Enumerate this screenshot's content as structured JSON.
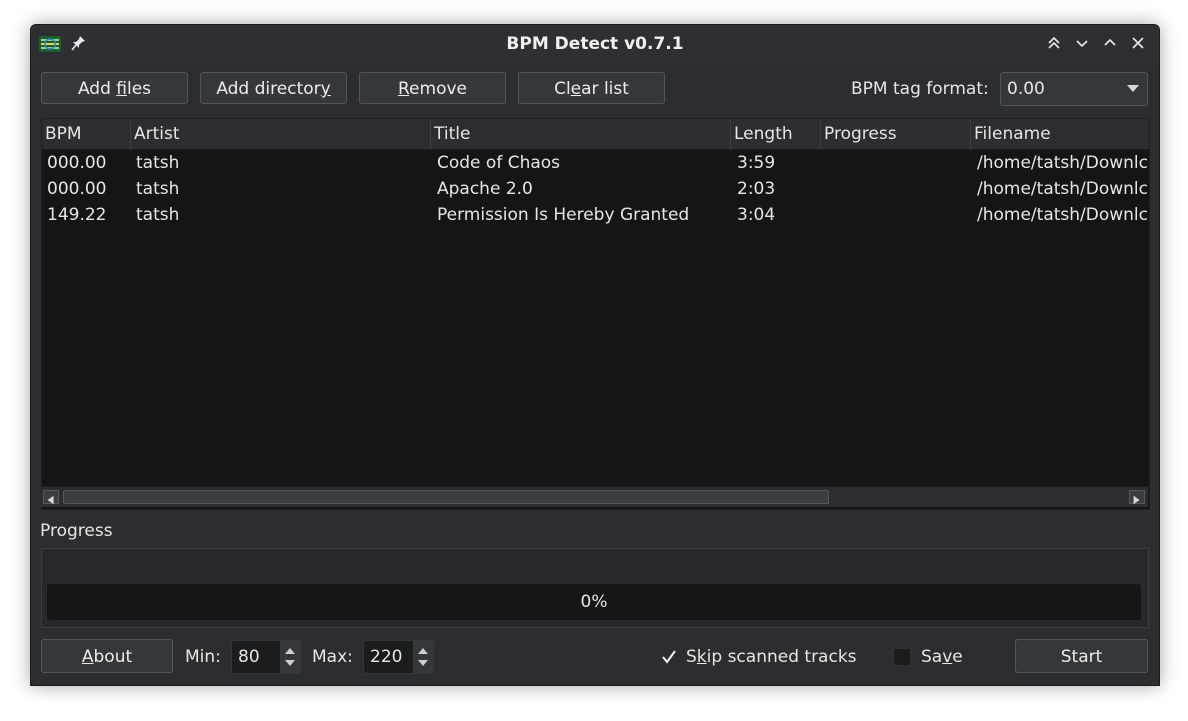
{
  "window": {
    "title": "BPM Detect v0.7.1",
    "icons": [
      "app-icon",
      "pin-icon",
      "keep-above-icon",
      "minimize-icon",
      "maximize-icon",
      "close-icon"
    ]
  },
  "toolbar": {
    "add_files": {
      "pre": "Add ",
      "key": "f",
      "post": "iles"
    },
    "add_directory": {
      "pre": "Add director",
      "key": "y",
      "post": ""
    },
    "remove": {
      "pre": "",
      "key": "R",
      "post": "emove"
    },
    "clear_list": {
      "pre": "Cl",
      "key": "e",
      "post": "ar list"
    },
    "bpm_tag_format_label": "BPM tag format:",
    "bpm_tag_format_value": "0.00"
  },
  "table": {
    "columns": [
      "BPM",
      "Artist",
      "Title",
      "Length",
      "Progress",
      "Filename"
    ],
    "rows": [
      {
        "bpm": "000.00",
        "artist": "tatsh",
        "title": "Code of Chaos",
        "length": "3:59",
        "progress": "",
        "filename": "/home/tatsh/Downlc"
      },
      {
        "bpm": "000.00",
        "artist": "tatsh",
        "title": "Apache 2.0",
        "length": "2:03",
        "progress": "",
        "filename": "/home/tatsh/Downlc"
      },
      {
        "bpm": "149.22",
        "artist": "tatsh",
        "title": "Permission Is Hereby Granted",
        "length": "3:04",
        "progress": "",
        "filename": "/home/tatsh/Downlc"
      }
    ]
  },
  "progress": {
    "label": "Progress",
    "percent_text": "0%",
    "fraction": 0
  },
  "footer": {
    "about": {
      "pre": "",
      "key": "A",
      "post": "bout"
    },
    "min_label": "Min:",
    "min_value": "80",
    "max_label": "Max:",
    "max_value": "220",
    "skip_scanned": {
      "pre": "S",
      "key": "k",
      "post": "ip scanned tracks",
      "checked": true
    },
    "save": {
      "pre": "Sa",
      "key": "v",
      "post": "e",
      "checked": false
    },
    "start": "Start"
  }
}
